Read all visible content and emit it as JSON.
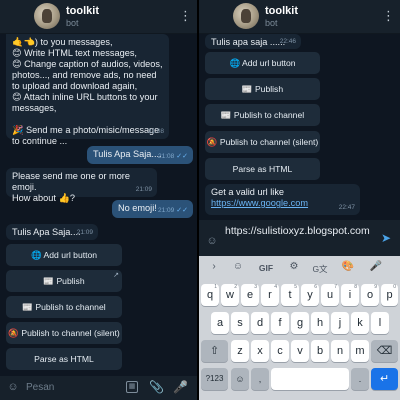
{
  "left": {
    "header": {
      "title": "toolkit",
      "subtitle": "bot"
    },
    "messages": {
      "intro_text": "🤙👈) to you messages,\n😊 Write HTML text messages,\n😊 Change caption of audios, videos, photos..., and remove ads, no need to upload and download again,\n😊 Attach inline URL buttons to your messages,\n\n🎉 Send me a photo/misic/message to continue ...",
      "intro_time": "21:08",
      "out1_text": "Tulis Apa Saja....",
      "out1_time": "21:08",
      "in2_text": "Please send me one or more emoji.\nHow about 👍?",
      "in2_time": "21:09",
      "out2_text": "No emoji!",
      "out2_time": "21:09",
      "in3_text": "Tulis Apa Saja....",
      "in3_time": "21:09"
    },
    "buttons": {
      "add_url": "🌐 Add url button",
      "publish": "📰 Publish",
      "publish_channel": "📰 Publish to channel",
      "publish_channel_silent": "🔕 Publish to channel (silent)",
      "parse_html": "Parse as HTML"
    },
    "input": {
      "placeholder": "Pesan"
    }
  },
  "right": {
    "header": {
      "title": "toolkit",
      "subtitle": "bot"
    },
    "messages": {
      "in1_text": "Tulis apa saja ......",
      "in1_time": "22:46",
      "in2_text": "Get a valid url like ",
      "in2_link": "https://www.google.com",
      "in2_time": "22:47"
    },
    "buttons": {
      "add_url": "🌐 Add url button",
      "publish": "📰 Publish",
      "publish_channel": "📰 Publish to channel",
      "publish_channel_silent": "🔕 Publish to channel (silent)",
      "parse_html": "Parse as HTML"
    },
    "input": {
      "value": "https://sulistioxyz.blogspot.com"
    },
    "keyboard": {
      "suggestions": [
        "›",
        "☺",
        "GIF",
        "⚙",
        "G文",
        "🎨",
        "🎤"
      ],
      "row1": [
        [
          "q",
          "1"
        ],
        [
          "w",
          "2"
        ],
        [
          "e",
          "3"
        ],
        [
          "r",
          "4"
        ],
        [
          "t",
          "5"
        ],
        [
          "y",
          "6"
        ],
        [
          "u",
          "7"
        ],
        [
          "i",
          "8"
        ],
        [
          "o",
          "9"
        ],
        [
          "p",
          "0"
        ]
      ],
      "row2": [
        "a",
        "s",
        "d",
        "f",
        "g",
        "h",
        "j",
        "k",
        "l"
      ],
      "row3": [
        "z",
        "x",
        "c",
        "v",
        "b",
        "n",
        "m"
      ],
      "shift": "⇧",
      "backspace": "⌫",
      "symbols": "?123",
      "emoji": "☺",
      "comma": ",",
      "period": ".",
      "enter": "↵"
    }
  },
  "colors": {
    "background": "#0e1621",
    "header": "#17212b",
    "incoming": "#182533",
    "outgoing": "#2b5278",
    "link": "#6ab3f3",
    "keyboard": "#cfd3d8",
    "enter": "#1a73e8"
  },
  "icons": {
    "left_header_menu": "more-vert-icon",
    "right_header_menu": "more-vert-icon",
    "sticker": "sticker-icon",
    "commands": "bot-commands-icon",
    "attach": "paperclip-icon",
    "mic": "microphone-icon",
    "send": "send-icon"
  }
}
